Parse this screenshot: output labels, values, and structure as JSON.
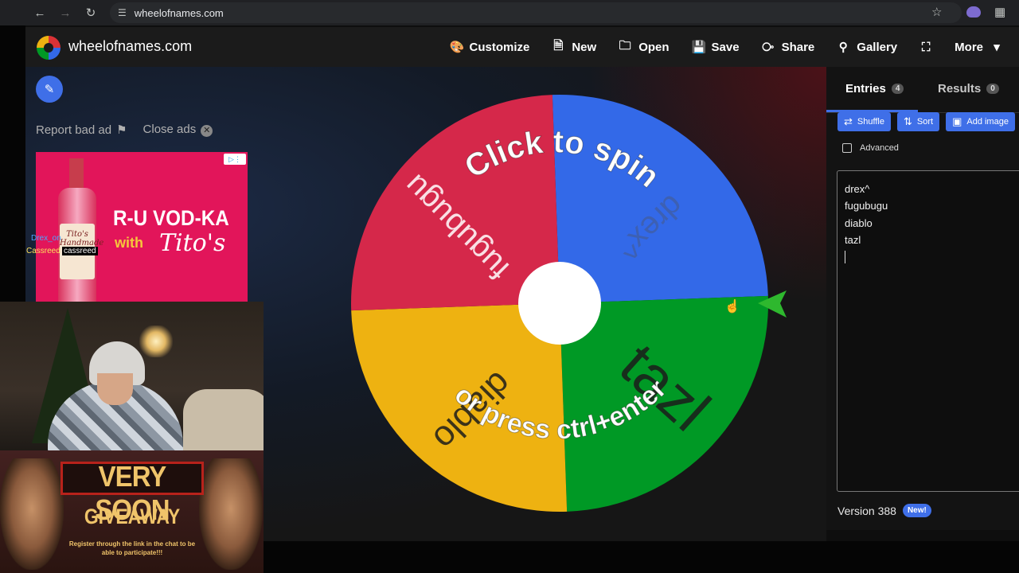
{
  "browser": {
    "url": "wheelofnames.com"
  },
  "app": {
    "site_name": "wheelofnames.com",
    "menu": [
      {
        "label": "Customize",
        "icon": "palette-icon"
      },
      {
        "label": "New",
        "icon": "file-icon"
      },
      {
        "label": "Open",
        "icon": "folder-icon"
      },
      {
        "label": "Save",
        "icon": "floppy-icon"
      },
      {
        "label": "Share",
        "icon": "share-icon"
      },
      {
        "label": "Gallery",
        "icon": "search-icon"
      },
      {
        "label": "",
        "icon": "fullscreen-icon"
      },
      {
        "label": "More",
        "icon": "caret-down-icon"
      }
    ]
  },
  "ads": {
    "report_label": "Report bad ad",
    "close_label": "Close ads",
    "banner_headline": "R-U VOD-KA",
    "banner_with": "with",
    "banner_brand": "Tito's",
    "bottle_label": "Tito's Handmade"
  },
  "stream": {
    "chat_user_1": "Drex_on",
    "chat_user_2": "Cassreed",
    "chat_user_3": "cassreed",
    "giveaway_title": "VERY SOON",
    "giveaway_sub": "GIVEAWAY",
    "giveaway_note": "Register through the link in the chat to be able to participate!!!"
  },
  "wheel": {
    "overlay_top": "Click to spin",
    "overlay_bottom": "or press ctrl+enter",
    "slices": [
      {
        "label": "drex^",
        "color": "#3369e8"
      },
      {
        "label": "tazl",
        "color": "#009925"
      },
      {
        "label": "diablo",
        "color": "#eeb211"
      },
      {
        "label": "fugubugu",
        "color": "#d5284a"
      }
    ],
    "pointer_color": "#2eb82e"
  },
  "panel": {
    "tab_entries": "Entries",
    "tab_entries_count": "4",
    "tab_results": "Results",
    "tab_results_count": "0",
    "shuffle_label": "Shuffle",
    "sort_label": "Sort",
    "add_image_label": "Add image",
    "advanced_label": "Advanced",
    "entries": [
      "drex^",
      "fugubugu",
      "diablo",
      "tazl"
    ],
    "version_label": "Version 388",
    "new_badge": "New!"
  },
  "colors": {
    "accent": "#3f6fe8",
    "header_bg": "#1b1b1b"
  }
}
